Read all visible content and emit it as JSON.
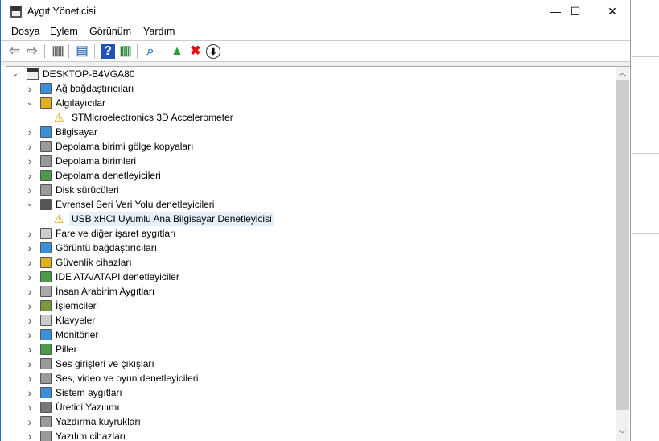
{
  "window": {
    "title": "Aygıt Yöneticisi",
    "minimize": "—",
    "maximize": "☐",
    "close": "✕"
  },
  "menu": [
    "Dosya",
    "Eylem",
    "Görünüm",
    "Yardım"
  ],
  "toolbar": [
    {
      "icon": "back-arrow-icon",
      "glyph": "⇦",
      "color": "#888"
    },
    {
      "icon": "forward-arrow-icon",
      "glyph": "⇨",
      "color": "#888"
    },
    {
      "icon": "show-hide-console-tree-icon",
      "glyph": "▥",
      "color": "#666"
    },
    {
      "icon": "properties-icon",
      "glyph": "▤",
      "color": "#4a7fc0"
    },
    {
      "icon": "help-icon",
      "glyph": "?",
      "color": "#fff",
      "bg": "#2451b8"
    },
    {
      "icon": "show-action-pane-icon",
      "glyph": "▥",
      "color": "#2a8a3a"
    },
    {
      "icon": "scan-hardware-icon",
      "glyph": "⌕",
      "color": "#2a7fd0"
    },
    {
      "icon": "update-driver-icon",
      "glyph": "▲",
      "color": "#2a9a3a"
    },
    {
      "icon": "uninstall-device-icon",
      "glyph": "✖",
      "color": "#e01010"
    },
    {
      "icon": "disable-device-icon",
      "glyph": "⬇",
      "color": "#000"
    }
  ],
  "tree": {
    "root": "DESKTOP-B4VGA80",
    "items": [
      {
        "label": "Ağ bağdaştırıcıları",
        "expanded": false,
        "color": "#3a8fd8"
      },
      {
        "label": "Algılayıcılar",
        "expanded": true,
        "color": "#e0b020",
        "children": [
          {
            "label": "STMicroelectronics 3D Accelerometer",
            "warning": true
          }
        ]
      },
      {
        "label": "Bilgisayar",
        "expanded": false,
        "color": "#3a8fd8"
      },
      {
        "label": "Depolama birimi gölge kopyaları",
        "expanded": false,
        "color": "#999"
      },
      {
        "label": "Depolama birimleri",
        "expanded": false,
        "color": "#999"
      },
      {
        "label": "Depolama denetleyicileri",
        "expanded": false,
        "color": "#4a9a4a"
      },
      {
        "label": "Disk sürücüleri",
        "expanded": false,
        "color": "#999"
      },
      {
        "label": "Evrensel Seri Veri Yolu denetleyicileri",
        "expanded": true,
        "color": "#555",
        "children": [
          {
            "label": "USB xHCI Uyumlu Ana Bilgisayar Denetleyicisi",
            "warning": true,
            "selected": true
          }
        ]
      },
      {
        "label": "Fare ve diğer işaret aygıtları",
        "expanded": false,
        "color": "#ccc"
      },
      {
        "label": "Görüntü bağdaştırıcıları",
        "expanded": false,
        "color": "#3a8fd8"
      },
      {
        "label": "Güvenlik cihazları",
        "expanded": false,
        "color": "#e0b020"
      },
      {
        "label": "IDE ATA/ATAPI denetleyiciler",
        "expanded": false,
        "color": "#4a9a4a"
      },
      {
        "label": "İnsan Arabirim Aygıtları",
        "expanded": false,
        "color": "#aaa"
      },
      {
        "label": "İşlemciler",
        "expanded": false,
        "color": "#7a9a3a"
      },
      {
        "label": "Klavyeler",
        "expanded": false,
        "color": "#ccc"
      },
      {
        "label": "Monitörler",
        "expanded": false,
        "color": "#3a8fd8"
      },
      {
        "label": "Piller",
        "expanded": false,
        "color": "#4a9a4a"
      },
      {
        "label": "Ses girişleri ve çıkışları",
        "expanded": false,
        "color": "#999"
      },
      {
        "label": "Ses, video ve oyun denetleyicileri",
        "expanded": false,
        "color": "#999"
      },
      {
        "label": "Sistem aygıtları",
        "expanded": false,
        "color": "#3a8fd8"
      },
      {
        "label": "Üretici Yazılımı",
        "expanded": false,
        "color": "#777"
      },
      {
        "label": "Yazdırma kuyrukları",
        "expanded": false,
        "color": "#999"
      },
      {
        "label": "Yazılım cihazları",
        "expanded": false,
        "color": "#999"
      }
    ]
  }
}
